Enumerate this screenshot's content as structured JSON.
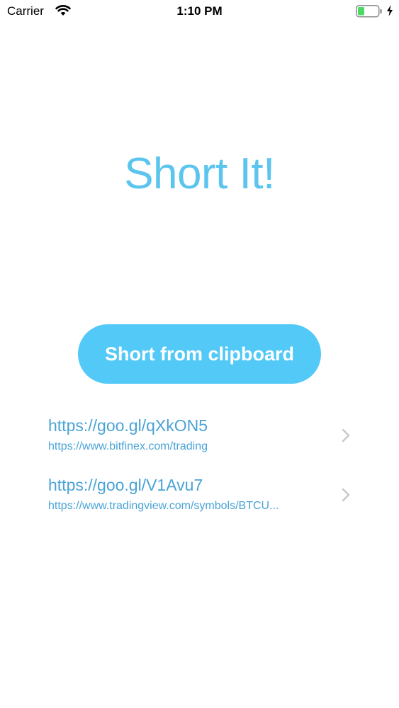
{
  "status_bar": {
    "carrier": "Carrier",
    "time": "1:10 PM",
    "battery_color": "#4cd964"
  },
  "main": {
    "title": "Short It!",
    "button_label": "Short from clipboard",
    "accent_color": "#52c9f7",
    "link_color": "#4aa3d6"
  },
  "links": [
    {
      "short_url": "https://goo.gl/qXkON5",
      "long_url": "https://www.bitfinex.com/trading"
    },
    {
      "short_url": "https://goo.gl/V1Avu7",
      "long_url": "https://www.tradingview.com/symbols/BTCU..."
    }
  ],
  "icons": {
    "wifi": "wifi-icon",
    "battery": "battery-icon",
    "charging": "charging-bolt-icon",
    "disclosure": "chevron-right-icon"
  }
}
